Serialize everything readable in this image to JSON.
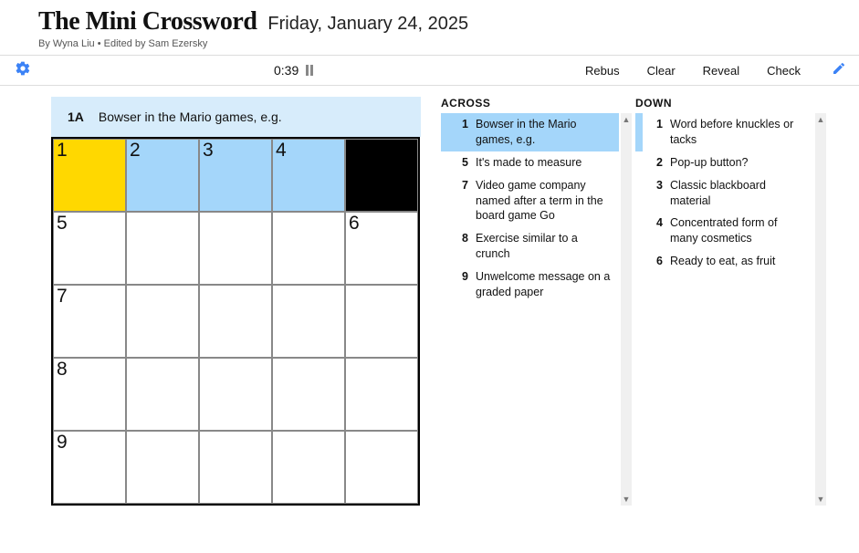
{
  "header": {
    "title": "The Mini Crossword",
    "date": "Friday, January 24, 2025",
    "byline_author": "By Wyna Liu",
    "byline_editor": "Edited by Sam Ezersky",
    "byline_sep": " • "
  },
  "toolbar": {
    "timer": "0:39",
    "rebus": "Rebus",
    "clear": "Clear",
    "reveal": "Reveal",
    "check": "Check"
  },
  "active_clue": {
    "label": "1A",
    "text": "Bowser in the Mario games, e.g."
  },
  "grid": {
    "rows": [
      [
        {
          "num": "1",
          "state": "selected"
        },
        {
          "num": "2",
          "state": "highlighted"
        },
        {
          "num": "3",
          "state": "highlighted"
        },
        {
          "num": "4",
          "state": "highlighted"
        },
        {
          "state": "black"
        }
      ],
      [
        {
          "num": "5"
        },
        {},
        {},
        {},
        {
          "num": "6"
        }
      ],
      [
        {
          "num": "7"
        },
        {},
        {},
        {},
        {}
      ],
      [
        {
          "num": "8"
        },
        {},
        {},
        {},
        {}
      ],
      [
        {
          "num": "9"
        },
        {},
        {},
        {},
        {}
      ]
    ]
  },
  "clues": {
    "across_heading": "ACROSS",
    "down_heading": "DOWN",
    "across": [
      {
        "num": "1",
        "text": "Bowser in the Mario games, e.g.",
        "active": true
      },
      {
        "num": "5",
        "text": "It's made to measure"
      },
      {
        "num": "7",
        "text": "Video game company named after a term in the board game Go"
      },
      {
        "num": "8",
        "text": "Exercise similar to a crunch"
      },
      {
        "num": "9",
        "text": "Unwelcome message on a graded paper"
      }
    ],
    "down": [
      {
        "num": "1",
        "text": "Word before knuckles or tacks",
        "related": true
      },
      {
        "num": "2",
        "text": "Pop-up button?"
      },
      {
        "num": "3",
        "text": "Classic blackboard material"
      },
      {
        "num": "4",
        "text": "Concentrated form of many cosmetics"
      },
      {
        "num": "6",
        "text": "Ready to eat, as fruit"
      }
    ]
  }
}
